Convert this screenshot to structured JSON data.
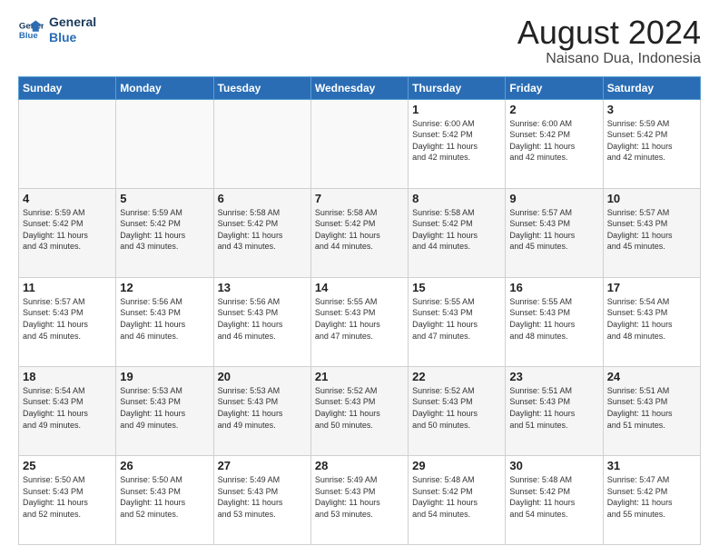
{
  "logo": {
    "line1": "General",
    "line2": "Blue"
  },
  "title": "August 2024",
  "location": "Naisano Dua, Indonesia",
  "days_of_week": [
    "Sunday",
    "Monday",
    "Tuesday",
    "Wednesday",
    "Thursday",
    "Friday",
    "Saturday"
  ],
  "weeks": [
    [
      {
        "day": "",
        "info": ""
      },
      {
        "day": "",
        "info": ""
      },
      {
        "day": "",
        "info": ""
      },
      {
        "day": "",
        "info": ""
      },
      {
        "day": "1",
        "info": "Sunrise: 6:00 AM\nSunset: 5:42 PM\nDaylight: 11 hours\nand 42 minutes."
      },
      {
        "day": "2",
        "info": "Sunrise: 6:00 AM\nSunset: 5:42 PM\nDaylight: 11 hours\nand 42 minutes."
      },
      {
        "day": "3",
        "info": "Sunrise: 5:59 AM\nSunset: 5:42 PM\nDaylight: 11 hours\nand 42 minutes."
      }
    ],
    [
      {
        "day": "4",
        "info": "Sunrise: 5:59 AM\nSunset: 5:42 PM\nDaylight: 11 hours\nand 43 minutes."
      },
      {
        "day": "5",
        "info": "Sunrise: 5:59 AM\nSunset: 5:42 PM\nDaylight: 11 hours\nand 43 minutes."
      },
      {
        "day": "6",
        "info": "Sunrise: 5:58 AM\nSunset: 5:42 PM\nDaylight: 11 hours\nand 43 minutes."
      },
      {
        "day": "7",
        "info": "Sunrise: 5:58 AM\nSunset: 5:42 PM\nDaylight: 11 hours\nand 44 minutes."
      },
      {
        "day": "8",
        "info": "Sunrise: 5:58 AM\nSunset: 5:42 PM\nDaylight: 11 hours\nand 44 minutes."
      },
      {
        "day": "9",
        "info": "Sunrise: 5:57 AM\nSunset: 5:43 PM\nDaylight: 11 hours\nand 45 minutes."
      },
      {
        "day": "10",
        "info": "Sunrise: 5:57 AM\nSunset: 5:43 PM\nDaylight: 11 hours\nand 45 minutes."
      }
    ],
    [
      {
        "day": "11",
        "info": "Sunrise: 5:57 AM\nSunset: 5:43 PM\nDaylight: 11 hours\nand 45 minutes."
      },
      {
        "day": "12",
        "info": "Sunrise: 5:56 AM\nSunset: 5:43 PM\nDaylight: 11 hours\nand 46 minutes."
      },
      {
        "day": "13",
        "info": "Sunrise: 5:56 AM\nSunset: 5:43 PM\nDaylight: 11 hours\nand 46 minutes."
      },
      {
        "day": "14",
        "info": "Sunrise: 5:55 AM\nSunset: 5:43 PM\nDaylight: 11 hours\nand 47 minutes."
      },
      {
        "day": "15",
        "info": "Sunrise: 5:55 AM\nSunset: 5:43 PM\nDaylight: 11 hours\nand 47 minutes."
      },
      {
        "day": "16",
        "info": "Sunrise: 5:55 AM\nSunset: 5:43 PM\nDaylight: 11 hours\nand 48 minutes."
      },
      {
        "day": "17",
        "info": "Sunrise: 5:54 AM\nSunset: 5:43 PM\nDaylight: 11 hours\nand 48 minutes."
      }
    ],
    [
      {
        "day": "18",
        "info": "Sunrise: 5:54 AM\nSunset: 5:43 PM\nDaylight: 11 hours\nand 49 minutes."
      },
      {
        "day": "19",
        "info": "Sunrise: 5:53 AM\nSunset: 5:43 PM\nDaylight: 11 hours\nand 49 minutes."
      },
      {
        "day": "20",
        "info": "Sunrise: 5:53 AM\nSunset: 5:43 PM\nDaylight: 11 hours\nand 49 minutes."
      },
      {
        "day": "21",
        "info": "Sunrise: 5:52 AM\nSunset: 5:43 PM\nDaylight: 11 hours\nand 50 minutes."
      },
      {
        "day": "22",
        "info": "Sunrise: 5:52 AM\nSunset: 5:43 PM\nDaylight: 11 hours\nand 50 minutes."
      },
      {
        "day": "23",
        "info": "Sunrise: 5:51 AM\nSunset: 5:43 PM\nDaylight: 11 hours\nand 51 minutes."
      },
      {
        "day": "24",
        "info": "Sunrise: 5:51 AM\nSunset: 5:43 PM\nDaylight: 11 hours\nand 51 minutes."
      }
    ],
    [
      {
        "day": "25",
        "info": "Sunrise: 5:50 AM\nSunset: 5:43 PM\nDaylight: 11 hours\nand 52 minutes."
      },
      {
        "day": "26",
        "info": "Sunrise: 5:50 AM\nSunset: 5:43 PM\nDaylight: 11 hours\nand 52 minutes."
      },
      {
        "day": "27",
        "info": "Sunrise: 5:49 AM\nSunset: 5:43 PM\nDaylight: 11 hours\nand 53 minutes."
      },
      {
        "day": "28",
        "info": "Sunrise: 5:49 AM\nSunset: 5:43 PM\nDaylight: 11 hours\nand 53 minutes."
      },
      {
        "day": "29",
        "info": "Sunrise: 5:48 AM\nSunset: 5:42 PM\nDaylight: 11 hours\nand 54 minutes."
      },
      {
        "day": "30",
        "info": "Sunrise: 5:48 AM\nSunset: 5:42 PM\nDaylight: 11 hours\nand 54 minutes."
      },
      {
        "day": "31",
        "info": "Sunrise: 5:47 AM\nSunset: 5:42 PM\nDaylight: 11 hours\nand 55 minutes."
      }
    ]
  ]
}
